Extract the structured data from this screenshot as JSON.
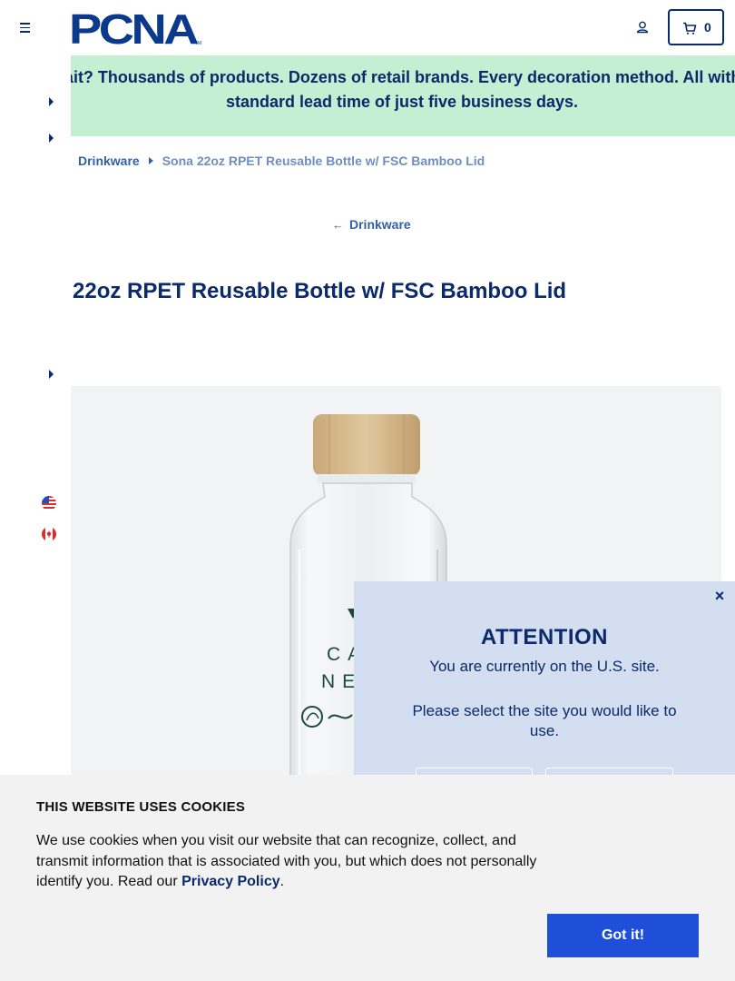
{
  "header": {
    "logo_text": "PCNA",
    "logo_tm": "TM",
    "cart_count": "0"
  },
  "banner": {
    "text": "Wait? Thousands of products. Dozens of retail brands. Every decoration method. All with a standard lead time of just five business days."
  },
  "breadcrumb": {
    "category": "Drinkware",
    "current": "Sona 22oz RPET Reusable Bottle w/ FSC Bamboo Lid"
  },
  "back_link": {
    "label": "Drinkware"
  },
  "product": {
    "title": "22oz RPET Reusable Bottle w/ FSC Bamboo Lid",
    "imprint_line1": "CAP",
    "imprint_line2": "NEU"
  },
  "site_popup": {
    "title": "ATTENTION",
    "line1": "You are currently on the U.S. site.",
    "line2": "Please select the site you would like to use.",
    "close": "×"
  },
  "cookie_banner": {
    "title": "THIS WEBSITE USES COOKIES",
    "text_before": "We use cookies when you visit our website that can recognize, collect, and transmit information that is associated with you, but which does not personally identify you. Read our ",
    "link": "Privacy Policy",
    "text_after": ".",
    "button": "Got it!"
  },
  "colors": {
    "brand_navy": "#0b2a6b",
    "banner_green": "#c4efd3",
    "popup_blue": "#d3def0",
    "cookie_button": "#1f4fd8"
  }
}
